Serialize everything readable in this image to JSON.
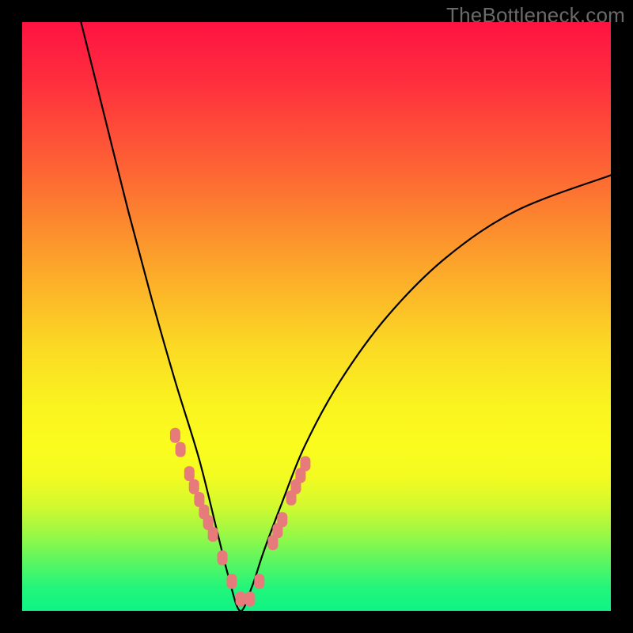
{
  "watermark": "TheBottleneck.com",
  "gradient_colors": {
    "top": "#fe1341",
    "mid_upper": "#fca02b",
    "mid": "#fbd924",
    "mid_lower": "#faf31f",
    "green_band": "#24f57a",
    "bottom": "#0ef485"
  },
  "chart_data": {
    "type": "line",
    "title": "",
    "xlabel": "",
    "ylabel": "",
    "xlim": [
      0,
      100
    ],
    "ylim": [
      0,
      100
    ],
    "note": "Axes are unlabeled in the source image; x/y are normalized 0–100 within the colored plot area. y=0 is the bottom (green) edge, y=100 is the top (red) edge.",
    "minimum_x": 37,
    "minimum_y": 0,
    "series": [
      {
        "name": "bottleneck-curve",
        "x": [
          10,
          14,
          18,
          22,
          26,
          30,
          33,
          35,
          37,
          39,
          41,
          44,
          48,
          54,
          62,
          72,
          84,
          100
        ],
        "y": [
          100,
          84,
          68,
          53,
          39,
          26,
          14,
          6,
          0,
          4,
          10,
          18,
          28,
          39,
          50,
          60,
          68,
          74
        ]
      }
    ],
    "markers": {
      "name": "bead-markers",
      "note": "Salmon-colored rounded markers overlaid on the curve near the valley.",
      "color": "#e77a7a",
      "x": [
        26.0,
        26.9,
        28.4,
        29.2,
        30.1,
        30.9,
        31.6,
        32.4,
        34.0,
        35.6,
        37.1,
        38.7,
        40.3,
        42.6,
        43.4,
        44.2,
        45.7,
        46.5,
        47.3,
        48.1
      ],
      "y": [
        29.8,
        27.4,
        23.3,
        21.1,
        18.9,
        16.8,
        15.0,
        13.0,
        9.0,
        5.0,
        2.0,
        2.0,
        5.0,
        11.6,
        13.6,
        15.5,
        19.2,
        21.1,
        23.0,
        25.0
      ]
    }
  }
}
